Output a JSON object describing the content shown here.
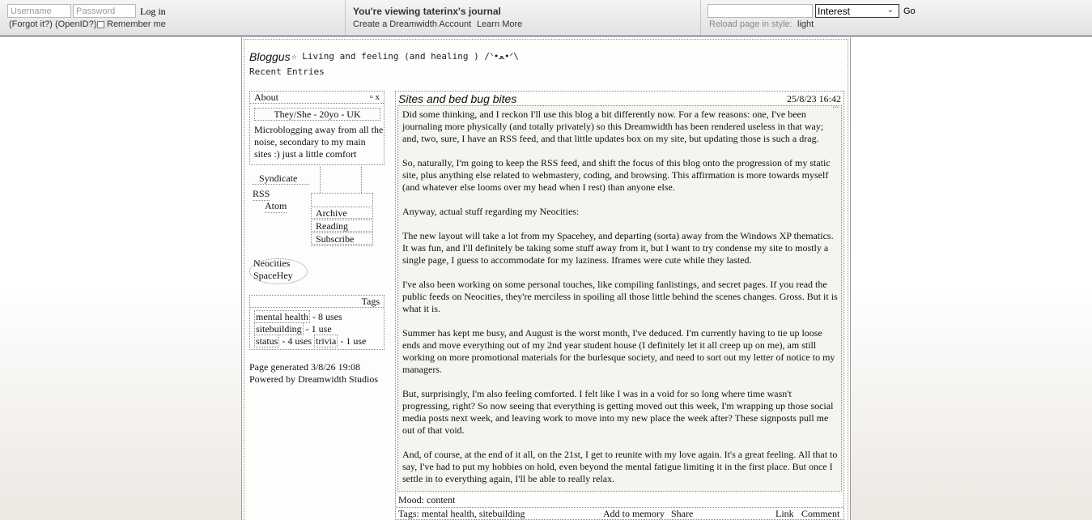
{
  "topnav": {
    "username_placeholder": "Username",
    "password_placeholder": "Password",
    "login_label": "Log in",
    "forgot_label": "(Forgot it?)",
    "openid_label": "(OpenID?)",
    "remember_label": "Remember me",
    "viewing_text": "You're viewing taterinx's journal",
    "create_account_label": "Create a Dreamwidth Account",
    "learn_more_label": "Learn More",
    "search_select_value": "Interest",
    "go_label": "Go",
    "reload_label": "Reload page in style:",
    "reload_style": "light"
  },
  "header": {
    "title": "Bloggus",
    "subtitle": "☆ Living and feeling (and healing ) /ᐠ•ﻌ•ᐟ\\",
    "recent_entries": "Recent Entries"
  },
  "sidebar": {
    "about": {
      "heading": "About",
      "controls": "▫ x",
      "pronouns": "They/She - 20yo - UK",
      "text": "Microblogging away from all the noise, secondary to my main sites :) just a little comfort"
    },
    "syndicate_label": "Syndicate",
    "rss_label": "RSS",
    "atom_label": "Atom",
    "nav": [
      {
        "label": "Archive"
      },
      {
        "label": "Reading"
      },
      {
        "label": "Subscribe"
      }
    ],
    "links": [
      {
        "label": "Neocities"
      },
      {
        "label": "SpaceHey"
      }
    ],
    "tags": {
      "heading": "Tags",
      "items": [
        {
          "name": "mental health",
          "count": "- 8 uses"
        },
        {
          "name": "sitebuilding",
          "count": "- 1 use"
        },
        {
          "name": "status",
          "count": "- 4 uses"
        },
        {
          "name": "trivia",
          "count": "- 1 use"
        }
      ]
    },
    "generated": "Page generated 3/8/26 19:08",
    "powered_by": "Powered by Dreamwidth Studios"
  },
  "entry": {
    "title": "Sites and bed bug bites",
    "date": "25/8/23 16:42",
    "dots": "...",
    "paragraphs": [
      "Did some thinking, and I reckon I'll use this blog a bit differently now. For a few reasons: one, I've been journaling more physically (and totally privately) so this Dreamwidth has been rendered useless in that way; and, two, sure, I have an RSS feed, and that little updates box on my site, but updating those is such a drag.",
      "So, naturally, I'm going to keep the RSS feed, and shift the focus of this blog onto the progression of my static site, plus anything else related to webmastery, coding, and browsing. This affirmation is more towards myself (and whatever else looms over my head when I rest) than anyone else.",
      "Anyway, actual stuff regarding my Neocities:",
      "The new layout will take a lot from my Spacehey, and departing (sorta) away from the Windows XP thematics. It was fun, and I'll definitely be taking some stuff away from it, but I want to try condense my site to mostly a single page, I guess to accommodate for my laziness. Iframes were cute while they lasted.",
      "I've also been working on some personal touches, like compiling fanlistings, and secret pages. If you read the public feeds on Neocities, they're merciless in spoiling all those little behind the scenes changes. Gross. But it is what it is.",
      "Summer has kept me busy, and August is the worst month, I've deduced. I'm currently having to tie up loose ends and move everything out of my 2nd year student house (I definitely let it all creep up on me), am still working on more promotional materials for the burlesque society, and need to sort out my letter of notice to my managers.",
      "But, surprisingly, I'm also feeling comforted. I felt like I was in a void for so long where time wasn't progressing, right? So now seeing that everything is getting moved out this week, I'm wrapping up those social media posts next week, and leaving work to move into my new place the week after? These signposts pull me out of that void.",
      "And, of course, at the end of it all, on the 21st, I get to reunite with my love again. It's a great feeling. All that to say, I've had to put my hobbies on hold, even beyond the mental fatigue limiting it in the first place. But once I settle in to everything again, I'll be able to really relax."
    ],
    "mood": "Mood: content",
    "tags_line": "Tags: mental health, sitebuilding",
    "add_to_memory": "Add to memory",
    "share": "Share",
    "link": "Link",
    "comment": "Comment"
  }
}
